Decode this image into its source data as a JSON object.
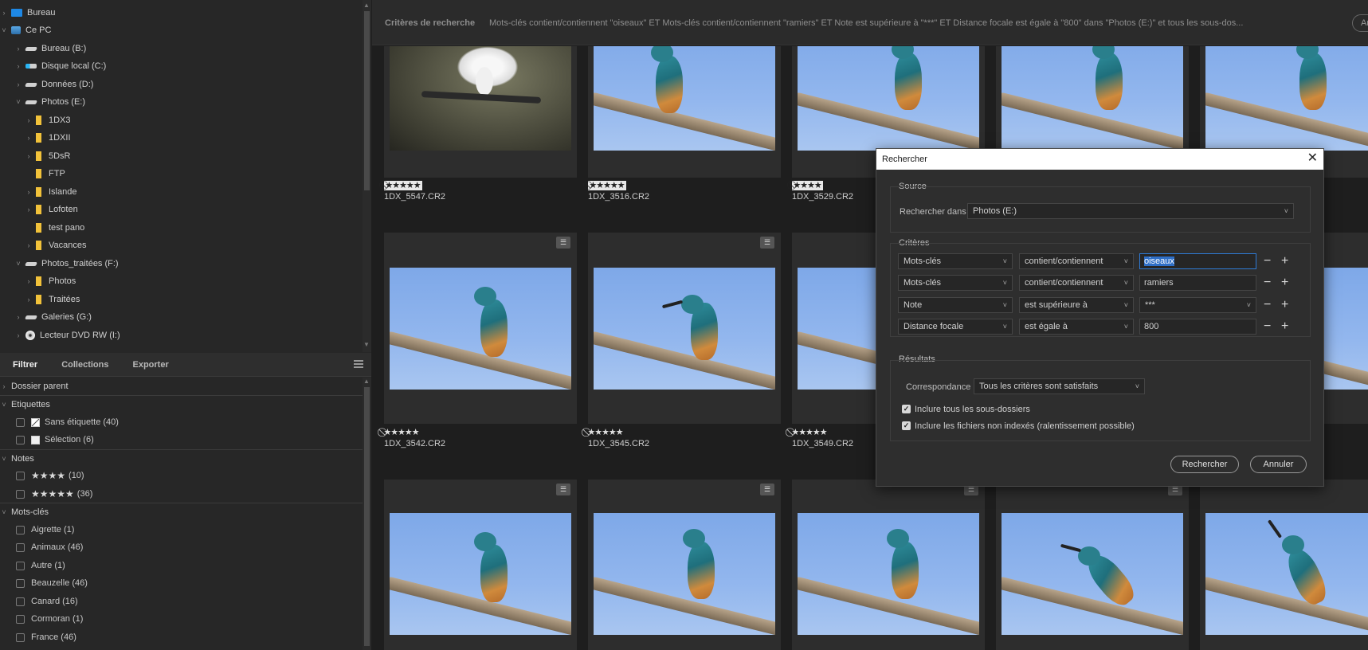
{
  "tree": {
    "items": [
      {
        "label": "Bureau",
        "icon": "monitor-icon"
      },
      {
        "label": "Ce PC",
        "icon": "pc-icon"
      },
      {
        "label": "Bureau (B:)",
        "icon": "drive-icon"
      },
      {
        "label": "Disque local (C:)",
        "icon": "windows-drive-icon"
      },
      {
        "label": "Données (D:)",
        "icon": "drive-icon"
      },
      {
        "label": "Photos (E:)",
        "icon": "drive-icon"
      },
      {
        "label": "1DX3",
        "icon": "folder-icon"
      },
      {
        "label": "1DXII",
        "icon": "folder-icon"
      },
      {
        "label": "5DsR",
        "icon": "folder-icon"
      },
      {
        "label": "FTP",
        "icon": "folder-icon"
      },
      {
        "label": "Islande",
        "icon": "folder-icon"
      },
      {
        "label": "Lofoten",
        "icon": "folder-icon"
      },
      {
        "label": "test pano",
        "icon": "folder-icon"
      },
      {
        "label": "Vacances",
        "icon": "folder-icon"
      },
      {
        "label": "Photos_traitées (F:)",
        "icon": "drive-icon"
      },
      {
        "label": "Photos",
        "icon": "folder-icon"
      },
      {
        "label": "Traitées",
        "icon": "folder-icon"
      },
      {
        "label": "Galeries (G:)",
        "icon": "drive-icon"
      },
      {
        "label": "Lecteur DVD RW (I:)",
        "icon": "dvd-icon"
      }
    ]
  },
  "tabs": [
    "Filtrer",
    "Collections",
    "Exporter"
  ],
  "filter": {
    "dossier_parent": "Dossier parent",
    "etiquettes": "Etiquettes",
    "sans_etiquette": "Sans étiquette (40)",
    "selection": "Sélection (6)",
    "notes": "Notes",
    "note4_stars": "★★★★",
    "note4_count": "(10)",
    "note5_stars": "★★★★★",
    "note5_count": "(36)",
    "mots_cles": "Mots-clés",
    "keywords": [
      "Aigrette (1)",
      "Animaux (46)",
      "Autre (1)",
      "Beauzelle (46)",
      "Canard (16)",
      "Cormoran (1)",
      "France (46)"
    ]
  },
  "search": {
    "title": "Critères de recherche",
    "text": "Mots-clés contient/contiennent \"oiseaux\" ET Mots-clés contient/contiennent \"ramiers\" ET Note est supérieure à \"***\" ET Distance focale est égale à \"800\" dans \"Photos (E:)\" et tous les sous-dos...",
    "button": "An"
  },
  "grid": {
    "row1": [
      {
        "rating": "⃠★★★★★",
        "name": "1DX_5547.CR2"
      },
      {
        "rating": "⃠★★★★★",
        "name": "1DX_3516.CR2"
      },
      {
        "rating": "⃠★★★★",
        "name": "1DX_3529.CR2"
      }
    ],
    "row2": [
      {
        "rating": "⃠★★★★★",
        "name": "1DX_3542.CR2"
      },
      {
        "rating": "⃠★★★★★",
        "name": "1DX_3545.CR2"
      },
      {
        "rating": "⃠★★★★★",
        "name": "1DX_3549.CR2"
      }
    ]
  },
  "dialog": {
    "title": "Rechercher",
    "source_label": "Source",
    "search_in_label": "Rechercher dans",
    "search_in_value": "Photos (E:)",
    "criteria_label": "Critères",
    "criteria": [
      {
        "field": "Mots-clés",
        "op": "contient/contiennent",
        "value": "oiseaux"
      },
      {
        "field": "Mots-clés",
        "op": "contient/contiennent",
        "value": "ramiers"
      },
      {
        "field": "Note",
        "op": "est supérieure à",
        "value": "***"
      },
      {
        "field": "Distance focale",
        "op": "est égale à",
        "value": "800"
      }
    ],
    "results_label": "Résultats",
    "match_label": "Correspondance",
    "match_value": "Tous les critères sont satisfaits",
    "include_subfolders": "Inclure tous les sous-dossiers",
    "include_unindexed": "Inclure les fichiers non indexés (ralentissement possible)",
    "search_button": "Rechercher",
    "cancel_button": "Annuler"
  }
}
